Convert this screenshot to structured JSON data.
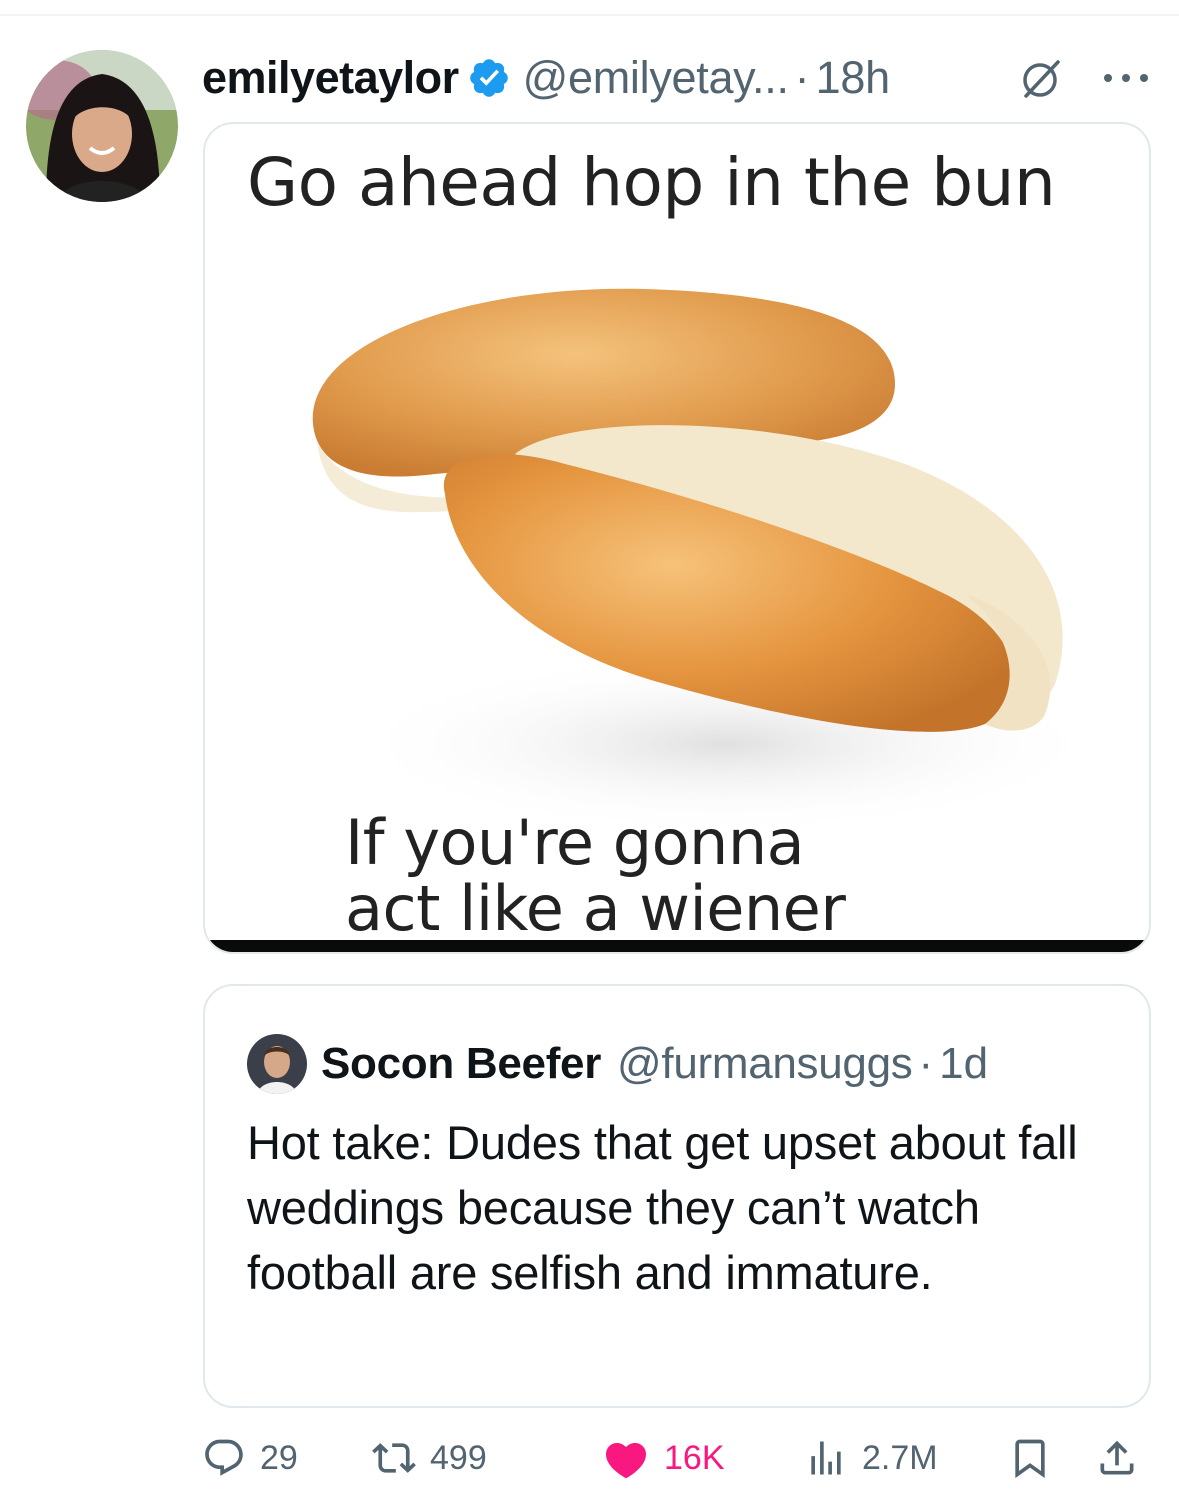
{
  "tweet": {
    "display_name": "emilyetaylor",
    "handle": "@emilyetay...",
    "separator": "·",
    "time": "18h",
    "verified_icon": "verified-badge-icon",
    "grok_icon": "grok-icon",
    "more_icon": "more-options-icon",
    "colors": {
      "verified": "#1d9bf0",
      "like": "#f91880",
      "muted": "#536471"
    }
  },
  "media": {
    "meme_top_text": "Go ahead hop in the bun",
    "meme_bottom_line1": "If you're gonna",
    "meme_bottom_line2": "act like a wiener"
  },
  "quote": {
    "display_name": "Socon Beefer",
    "handle": "@furmansuggs",
    "separator": "·",
    "time": "1d",
    "text": "Hot take: Dudes that get upset about fall weddings because they can’t watch football are selfish and immature."
  },
  "actions": {
    "reply_count": "29",
    "retweet_count": "499",
    "like_count": "16K",
    "views_count": "2.7M",
    "icons": [
      "reply-icon",
      "retweet-icon",
      "like-heart-icon",
      "views-chart-icon",
      "bookmark-icon",
      "share-icon"
    ]
  }
}
